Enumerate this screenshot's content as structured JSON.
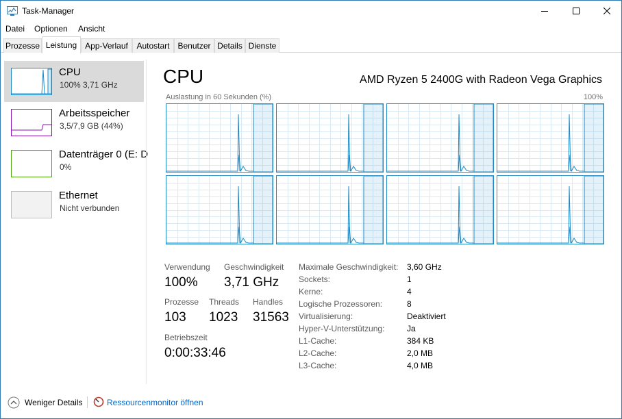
{
  "window": {
    "title": "Task-Manager"
  },
  "menu": [
    "Datei",
    "Optionen",
    "Ansicht"
  ],
  "tabs": [
    "Prozesse",
    "Leistung",
    "App-Verlauf",
    "Autostart",
    "Benutzer",
    "Details",
    "Dienste"
  ],
  "active_tab": "Leistung",
  "sidebar": {
    "items": [
      {
        "title": "CPU",
        "sub": "100%  3,71 GHz",
        "color": "#1b8ac6",
        "selected": true
      },
      {
        "title": "Arbeitsspeicher",
        "sub": "3,5/7,9 GB (44%)",
        "color": "#8b12ae",
        "selected": false
      },
      {
        "title": "Datenträger 0 (E: D",
        "sub": "0%",
        "color": "#4da60c",
        "selected": false
      },
      {
        "title": "Ethernet",
        "sub": "Nicht verbunden",
        "color": "#bcbcbc",
        "selected": false
      }
    ]
  },
  "main": {
    "title": "CPU",
    "cpu_name": "AMD Ryzen 5 2400G with Radeon Vega Graphics",
    "graph_label": "Auslastung in 60 Sekunden (%)",
    "graph_max": "100%",
    "graph_count": 8,
    "graph_color": "#1d8ac6",
    "stats": {
      "usage_label": "Verwendung",
      "usage_value": "100%",
      "speed_label": "Geschwindigkeit",
      "speed_value": "3,71 GHz",
      "processes_label": "Prozesse",
      "processes_value": "103",
      "threads_label": "Threads",
      "threads_value": "1023",
      "handles_label": "Handles",
      "handles_value": "31563",
      "uptime_label": "Betriebszeit",
      "uptime_value": "0:00:33:46"
    },
    "info": [
      {
        "label": "Maximale Geschwindigkeit:",
        "value": "3,60 GHz"
      },
      {
        "label": "Sockets:",
        "value": "1"
      },
      {
        "label": "Kerne:",
        "value": "4"
      },
      {
        "label": "Logische Prozessoren:",
        "value": "8"
      },
      {
        "label": "Virtualisierung:",
        "value": "Deaktiviert"
      },
      {
        "label": "Hyper-V-Unterstützung:",
        "value": "Ja"
      },
      {
        "label": "L1-Cache:",
        "value": "384 KB"
      },
      {
        "label": "L2-Cache:",
        "value": "2,0 MB"
      },
      {
        "label": "L3-Cache:",
        "value": "4,0 MB"
      }
    ]
  },
  "footer": {
    "fewer_details": "Weniger Details",
    "resmon": "Ressourcenmonitor öffnen"
  }
}
